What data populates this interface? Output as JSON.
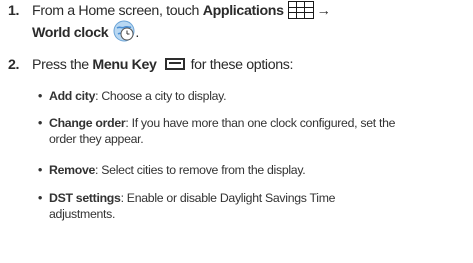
{
  "steps": [
    {
      "number": "1.",
      "line1_prefix": "From a Home screen, touch ",
      "line1_bold": "Applications",
      "line1_icon": "grid-icon",
      "line1_arrow": "→",
      "line2_bold": "World clock",
      "line2_icon": "globe-clock-icon",
      "line2_suffix": "."
    },
    {
      "number": "2.",
      "prefix": "Press the ",
      "bold": "Menu Key",
      "icon": "menu-key-icon",
      "suffix": "for these options:"
    }
  ],
  "options": [
    {
      "bullet": "•",
      "label": "Add city",
      "desc": ": Choose a city to display."
    },
    {
      "bullet": "•",
      "label": "Change order",
      "desc": ": If you have more than one clock configured, set the",
      "desc2": "order they appear."
    },
    {
      "bullet": "•",
      "label": "Remove",
      "desc": ": Select cities to remove from the display."
    },
    {
      "bullet": "•",
      "label": "DST settings",
      "desc": ": Enable or disable Daylight Savings Time",
      "desc2": "adjustments."
    }
  ],
  "colors": {
    "text": "#2b2b2b",
    "icon_globe_blue": "#4a8fd4",
    "icon_globe_light": "#b9d8f2"
  }
}
